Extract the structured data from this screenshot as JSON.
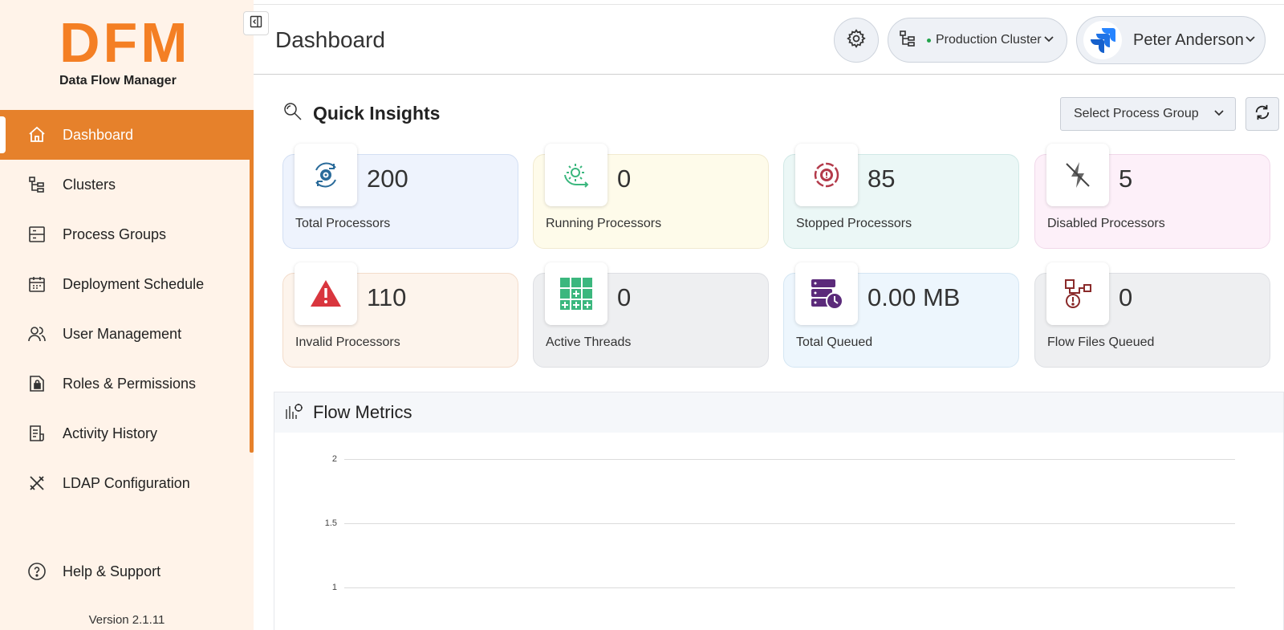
{
  "sidebar": {
    "logo_mark": "DFM",
    "logo_subtitle": "Data Flow Manager",
    "items": [
      {
        "label": "Dashboard",
        "icon": "home-icon",
        "active": true
      },
      {
        "label": "Clusters",
        "icon": "cluster-tree-icon"
      },
      {
        "label": "Process Groups",
        "icon": "process-groups-icon"
      },
      {
        "label": "Deployment Schedule",
        "icon": "calendar-icon"
      },
      {
        "label": "User Management",
        "icon": "users-icon"
      },
      {
        "label": "Roles & Permissions",
        "icon": "lock-file-icon"
      },
      {
        "label": "Activity History",
        "icon": "document-icon"
      },
      {
        "label": "LDAP Configuration",
        "icon": "tools-icon"
      }
    ],
    "help_label": "Help & Support",
    "version": "Version 2.1.11"
  },
  "header": {
    "title": "Dashboard",
    "cluster_label": "Production Cluster",
    "user_name": "Peter Anderson"
  },
  "quick_insights": {
    "title": "Quick Insights",
    "select_placeholder": "Select Process Group",
    "cards": [
      {
        "value": "200",
        "label": "Total Processors",
        "icon": "gear-cycle-icon",
        "bg": "#eef3fd",
        "border": "#d3dff3"
      },
      {
        "value": "0",
        "label": "Running Processors",
        "icon": "running-gear-icon",
        "bg": "#fefbea",
        "border": "#f1ead0"
      },
      {
        "value": "85",
        "label": "Stopped Processors",
        "icon": "stopped-gear-icon",
        "bg": "#ebf7f6",
        "border": "#d0e8e6"
      },
      {
        "value": "5",
        "label": "Disabled Processors",
        "icon": "disabled-bolt-icon",
        "bg": "#fdf0f9",
        "border": "#f1d8ea"
      },
      {
        "value": "110",
        "label": "Invalid Processors",
        "icon": "warning-icon",
        "bg": "#fdf4ec",
        "border": "#f3dccb"
      },
      {
        "value": "0",
        "label": "Active Threads",
        "icon": "threads-grid-icon",
        "bg": "#eeeff1",
        "border": "#dddfe3"
      },
      {
        "value": "0.00 MB",
        "label": "Total Queued",
        "icon": "queue-clock-icon",
        "bg": "#edf6fd",
        "border": "#d4e6f3"
      },
      {
        "value": "0",
        "label": "Flow Files Queued",
        "icon": "flowfile-alert-icon",
        "bg": "#eeeff1",
        "border": "#dddfe3"
      }
    ]
  },
  "flow_metrics": {
    "title": "Flow Metrics",
    "y_ticks": [
      "2",
      "1.5",
      "1"
    ]
  },
  "colors": {
    "accent": "#e6812b",
    "sidebar_bg": "#fff3e9"
  }
}
